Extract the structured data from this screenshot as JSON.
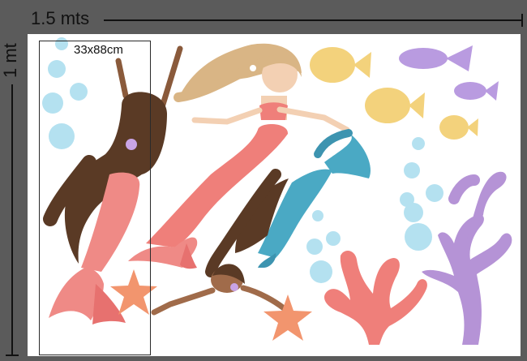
{
  "dimensions": {
    "width_label": "1.5 mts",
    "height_label": "1 mt",
    "crop_label": "33x88cm"
  },
  "colors": {
    "background": "#5b5b5b",
    "sheet": "#ffffff",
    "bubble": "#a8dcee",
    "coral_pink": "#ef7f7a",
    "seaweed_purple": "#b593d6",
    "fish_yellow": "#f3d27c",
    "fish_purple": "#b99be0",
    "tail_teal": "#4aa9c4",
    "tail_pink": "#ef8a86",
    "hair_blonde": "#d9b585",
    "hair_brown": "#5a3a25",
    "starfish": "#f2956e"
  }
}
